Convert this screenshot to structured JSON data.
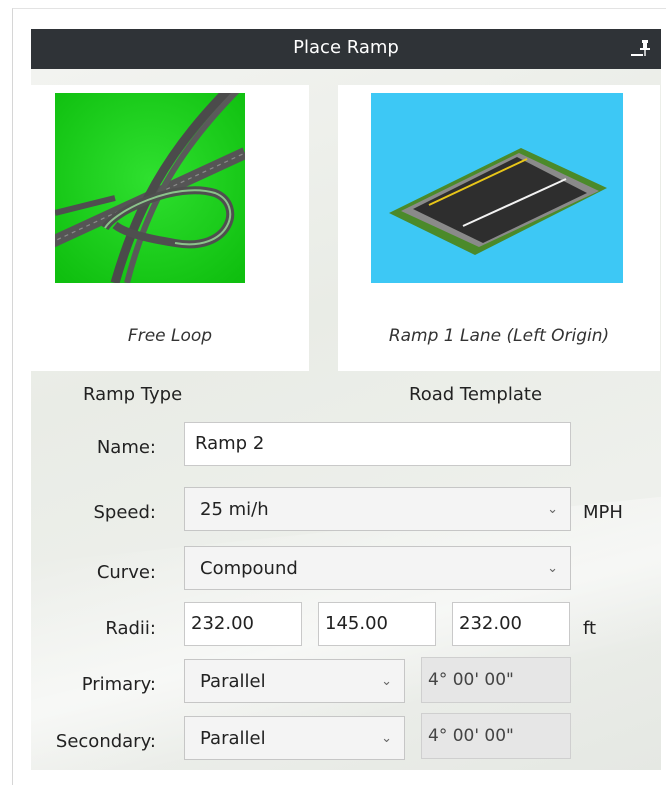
{
  "window": {
    "title": "Place Ramp"
  },
  "ramp_type": {
    "caption": "Free Loop",
    "label": "Ramp Type"
  },
  "road_template": {
    "caption": "Ramp 1 Lane (Left Origin)",
    "label": "Road Template"
  },
  "form": {
    "name": {
      "label": "Name:",
      "value": "Ramp 2"
    },
    "speed": {
      "label": "Speed:",
      "value": "25 mi/h",
      "unit": "MPH"
    },
    "curve": {
      "label": "Curve:",
      "value": "Compound"
    },
    "radii": {
      "label": "Radii:",
      "values": [
        "232.00",
        "145.00",
        "232.00"
      ],
      "unit": "ft"
    },
    "primary": {
      "label": "Primary:",
      "value": "Parallel",
      "angle": "4° 00' 00\""
    },
    "secondary": {
      "label": "Secondary:",
      "value": "Parallel",
      "angle": "4° 00' 00\""
    }
  },
  "icons": {
    "minimize": "minimize-icon",
    "pin": "pin-icon",
    "dropdown": "chevron-down-icon"
  },
  "colors": {
    "titlebar": "#2f3337",
    "thumb_green": "#19d419",
    "thumb_blue": "#3dc8f5"
  }
}
